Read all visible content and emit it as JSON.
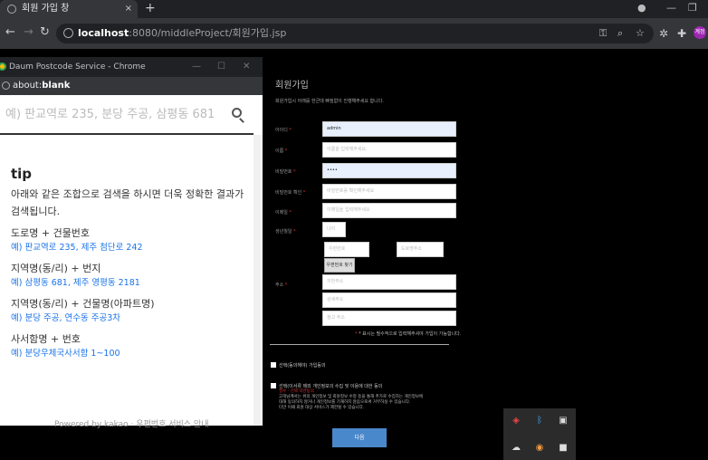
{
  "browser": {
    "tab_title": "회원 가입 창",
    "tab_close": "×",
    "new_tab": "+",
    "address_host": "localhost",
    "address_path": ":8080/middleProject/회원가입.jsp",
    "profile_text": "계정"
  },
  "popup": {
    "window_title": "Daum Postcode Service - Chrome",
    "address_prefix": "about:",
    "address_bold": "blank",
    "search_placeholder": "예) 판교역로 235, 분당 주공, 삼평동 681",
    "tip_title": "tip",
    "tip_desc": "아래와 같은 조합으로 검색을 하시면 더욱 정확한 결과가 검색됩니다.",
    "examples": [
      {
        "category": "도로명 + 건물번호",
        "example": "예) 판교역로 235,  제주 첨단로 242"
      },
      {
        "category": "지역명(동/리) + 번지",
        "example": "예) 삼평동 681,  제주 영평동 2181"
      },
      {
        "category": "지역명(동/리) + 건물명(아파트명)",
        "example": "예) 분당 주공,  연수동 주공3차"
      },
      {
        "category": "사서함명 + 번호",
        "example": "예) 분당우체국사서함 1~100"
      }
    ],
    "footer": "Powered by  kakao  ·  우편번호 서비스 안내"
  },
  "form": {
    "title": "회원가입",
    "description": "회원가입시 아래를 한군데 빠짐없이 진행해주세요 합니다.",
    "fields": [
      {
        "label": "아이디",
        "value": "admin",
        "placeholder": ""
      },
      {
        "label": "이름",
        "value": "",
        "placeholder": "이름을 입력해주세요."
      },
      {
        "label": "비밀번호",
        "value": "••••",
        "placeholder": ""
      },
      {
        "label": "비밀번호 확인",
        "value": "",
        "placeholder": "비밀번호를 확인해주세요"
      },
      {
        "label": "이메일",
        "value": "",
        "placeholder": "이메일을 입력해주세요"
      },
      {
        "label": "생년월일",
        "value": "",
        "placeholder": "나이"
      }
    ],
    "postcode_placeholder": "우편번호",
    "road_placeholder": "도로명주소",
    "search_postcode_button": "우편번호 찾기",
    "address_label": "주소",
    "address_placeholders": [
      "지번주소",
      "상세주소",
      "참고 주소"
    ],
    "required_note": "* 표시는 필수적으로 입력해주셔야 가입이 가능합니다.",
    "consent1": "선택(동의해야) 가입동의",
    "consent2": "선택(이서류 제외 개인정보의 수집 및 이용에 대한 동의",
    "terms_red": "필수 · 선택 약관동의",
    "terms_lines": [
      "고객님께서는 위의 개인정보 및 회원정보 수정 등을 통해 추가로 수집하는 개인정보에",
      "대해 동의하지 않거나 개인정보를 기재하지 않음으로써 거부하실 수 있습니다.",
      "다만 이때 회원 대상 서비스가 제한될 수 있습니다."
    ],
    "submit_label": "다음"
  }
}
